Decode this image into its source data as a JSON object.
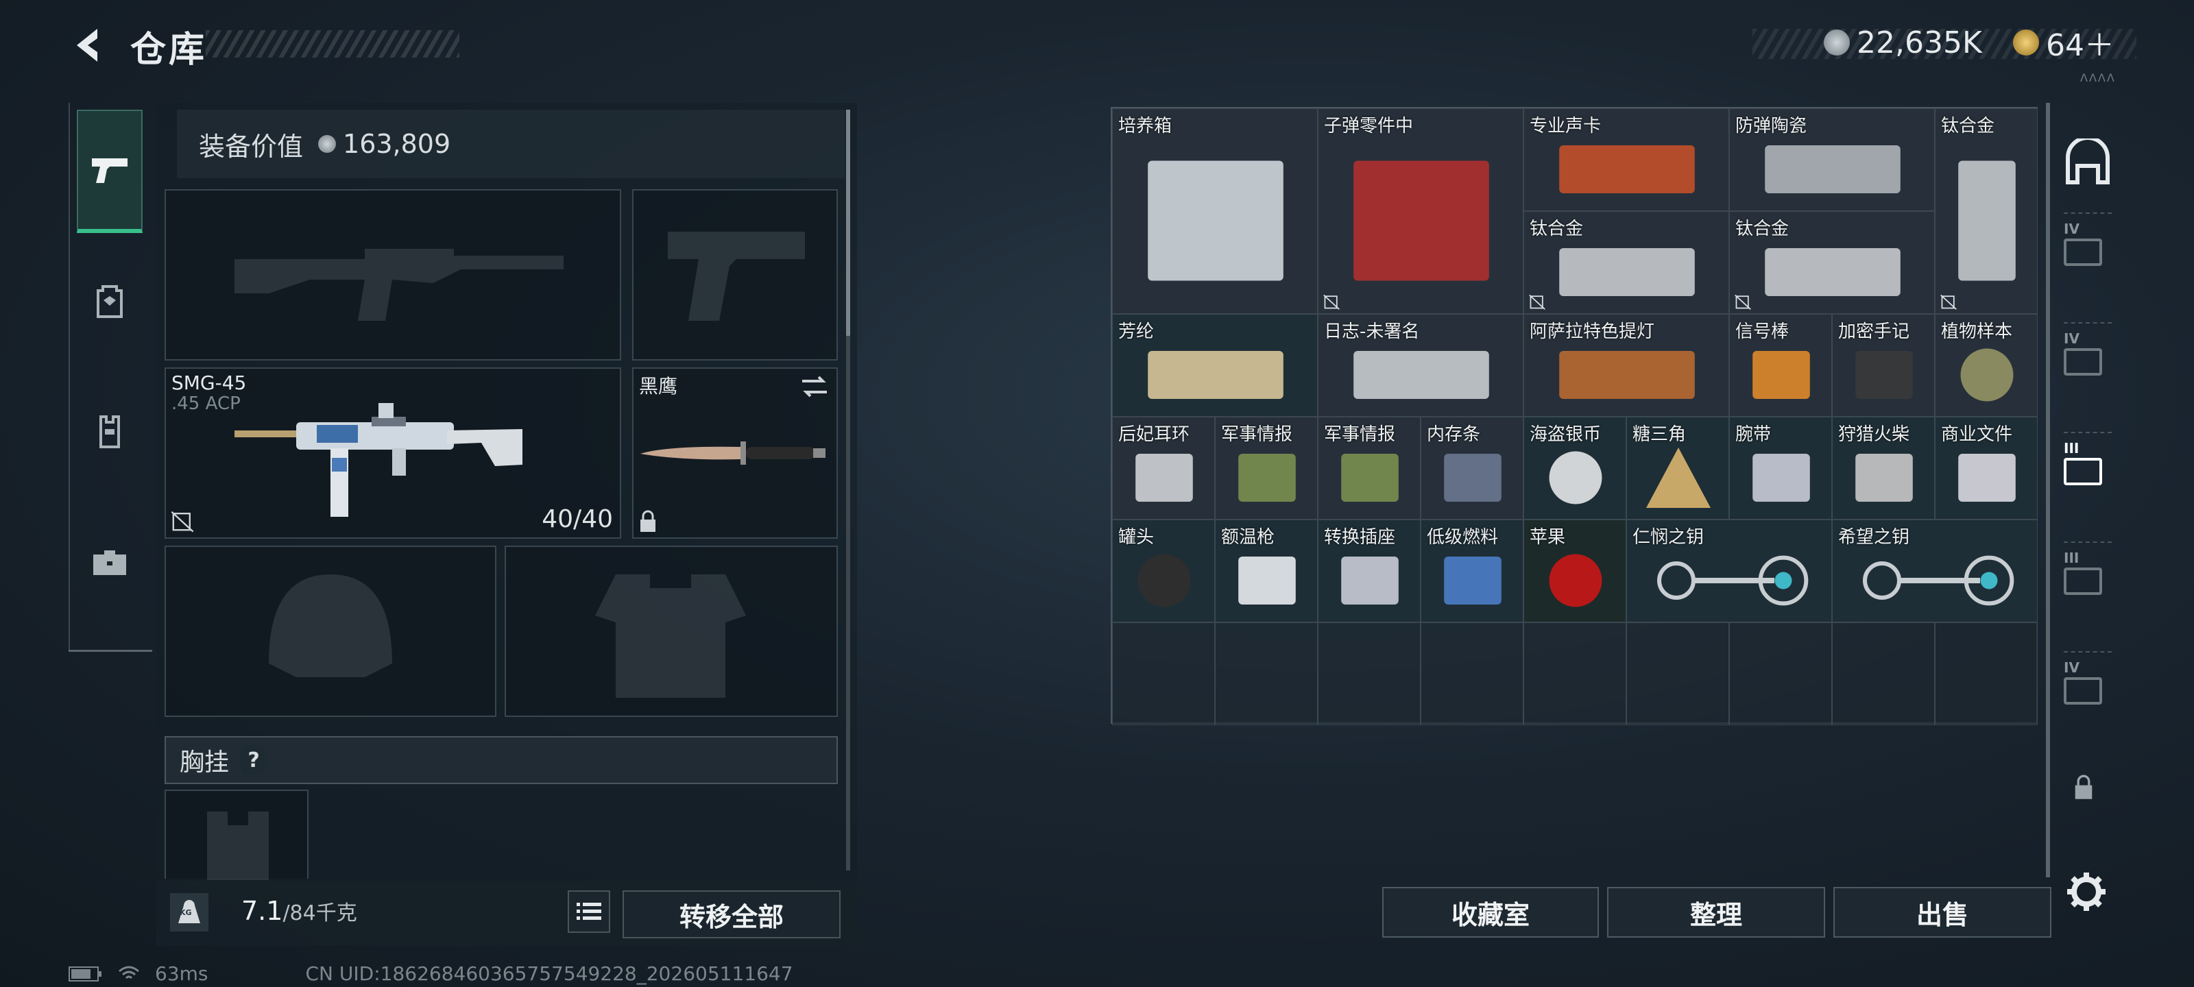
{
  "header": {
    "title": "仓库"
  },
  "currency": [
    {
      "icon": "silver-coin-icon",
      "value": "22,635K"
    },
    {
      "icon": "gold-coin-icon",
      "value": "64＋"
    }
  ],
  "sidebar": {
    "tabs": [
      {
        "name": "weapon",
        "icon": "pistol-icon",
        "active": true
      },
      {
        "name": "backpack",
        "icon": "backpack-icon",
        "active": false
      },
      {
        "name": "rig",
        "icon": "vest-icon",
        "active": false
      },
      {
        "name": "case",
        "icon": "briefcase-icon",
        "active": false
      }
    ]
  },
  "equipment": {
    "value_label": "装备价值",
    "value": "163,809",
    "primary_weapon": {
      "name": "SMG-45",
      "ammo": ".45 ACP",
      "count": "40/40"
    },
    "melee": {
      "name": "黑鹰"
    },
    "chest_rig_label": "胸挂",
    "help": "?"
  },
  "footer_left": {
    "weight_icon": "KG",
    "weight": "7.1",
    "capacity": "/84千克",
    "transfer_all": "转移全部"
  },
  "stash_items": [
    {
      "label": "培养箱"
    },
    {
      "label": "子弹零件中"
    },
    {
      "label": "专业声卡"
    },
    {
      "label": "防弹陶瓷"
    },
    {
      "label": "钛合金"
    },
    {
      "label": "钛合金"
    },
    {
      "label": "钛合金"
    },
    {
      "label": "芳纶"
    },
    {
      "label": "日志-未署名"
    },
    {
      "label": "阿萨拉特色提灯"
    },
    {
      "label": "信号棒"
    },
    {
      "label": "加密手记"
    },
    {
      "label": "植物样本"
    },
    {
      "label": "后妃耳环"
    },
    {
      "label": "军事情报"
    },
    {
      "label": "军事情报"
    },
    {
      "label": "内存条"
    },
    {
      "label": "海盗银币"
    },
    {
      "label": "糖三角"
    },
    {
      "label": "腕带"
    },
    {
      "label": "狩猎火柴"
    },
    {
      "label": "商业文件"
    },
    {
      "label": "罐头"
    },
    {
      "label": "额温枪"
    },
    {
      "label": "转换插座"
    },
    {
      "label": "低级燃料"
    },
    {
      "label": "苹果"
    },
    {
      "label": "仁悯之钥"
    },
    {
      "label": "希望之钥"
    }
  ],
  "right_tabs": [
    "IV",
    "IV",
    "III",
    "III",
    "IV"
  ],
  "actions": {
    "collection": "收藏室",
    "sort": "整理",
    "sell": "出售"
  },
  "status": {
    "ping": "63ms",
    "uid": "CN UID:18626846036575754922​8_202605111647"
  },
  "logo_text": "ΛΛΛΛ"
}
